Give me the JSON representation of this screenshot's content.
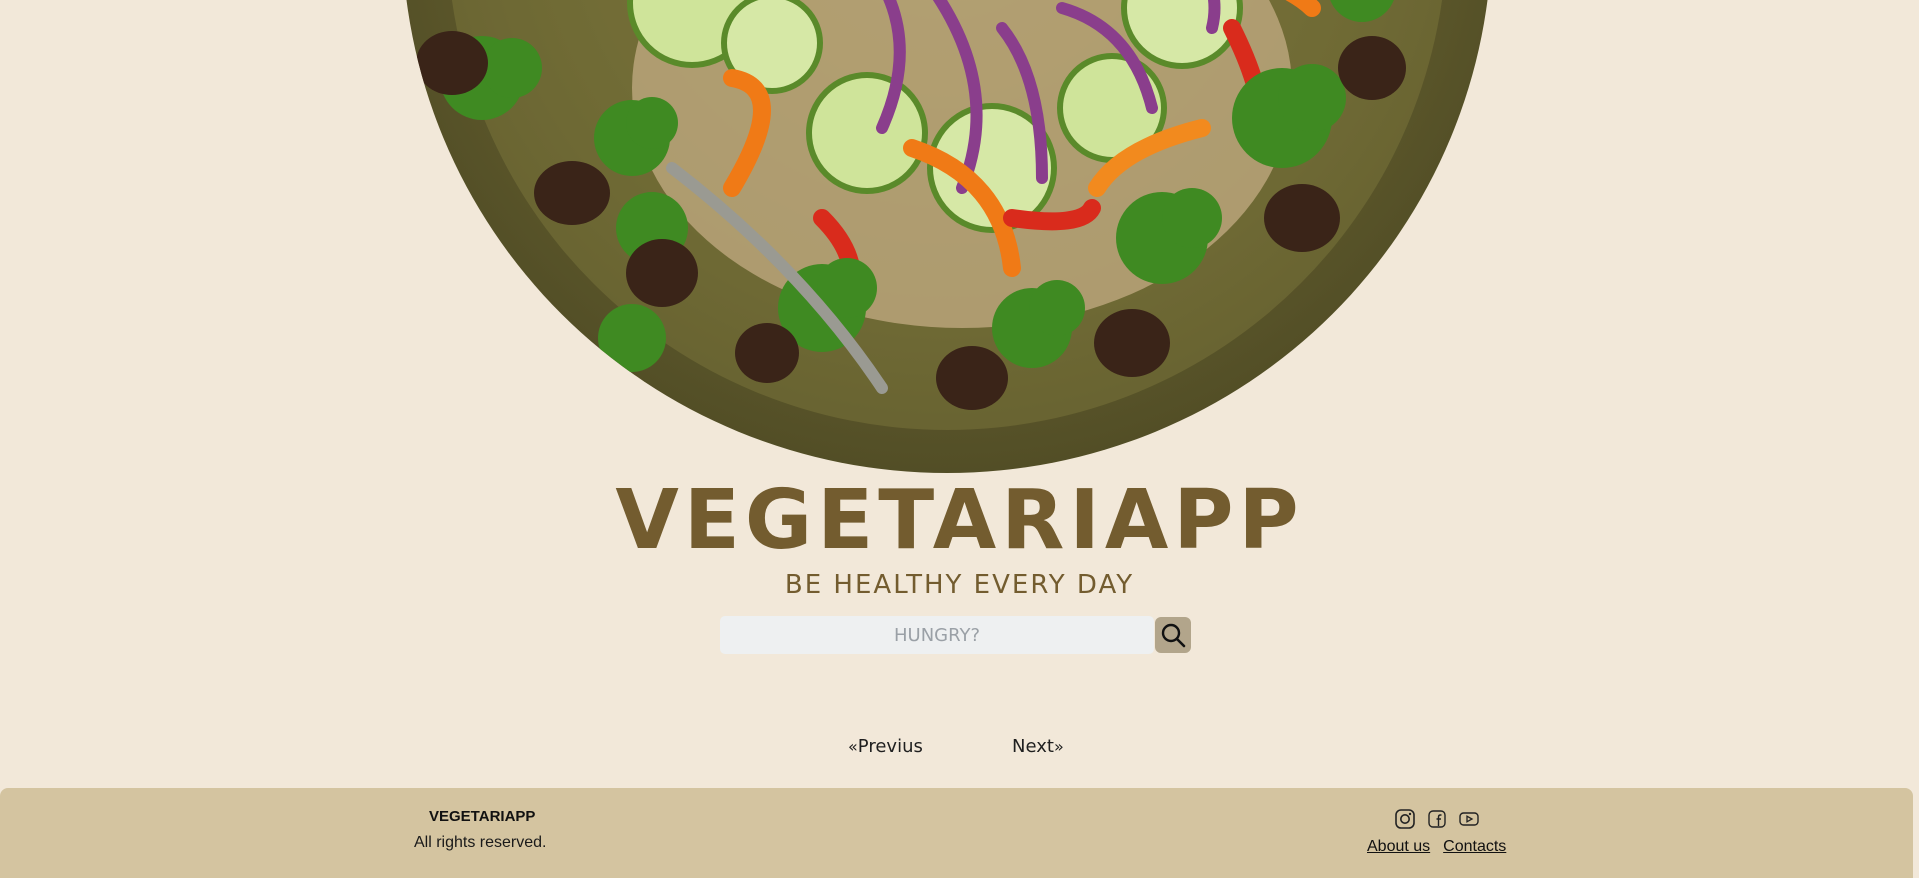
{
  "app": {
    "title": "VEGETARIAPP",
    "tagline": "BE HEALTHY EVERY DAY"
  },
  "search": {
    "placeholder": "HUNGRY?"
  },
  "pagination": {
    "previous_label": "Previus",
    "next_label": "Next"
  },
  "footer": {
    "brand": "VEGETARIAPP",
    "rights": "All rights reserved.",
    "social_icons": [
      "instagram-icon",
      "facebook-icon",
      "youtube-icon"
    ],
    "links": [
      {
        "label": "About us"
      },
      {
        "label": "Contacts"
      }
    ]
  },
  "colors": {
    "background": "#f2e8d9",
    "brand": "#735c2f",
    "footer": "#d4c4a0",
    "search_button": "#b2a58b"
  }
}
